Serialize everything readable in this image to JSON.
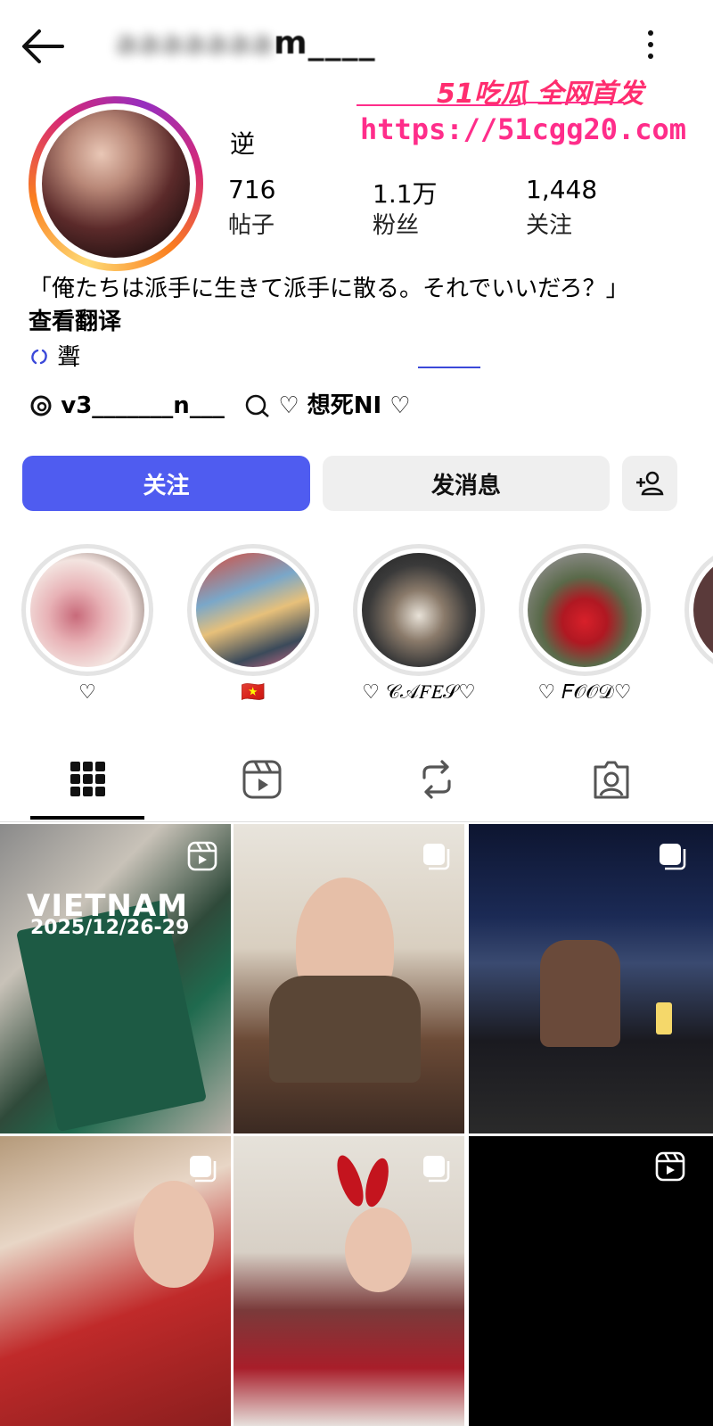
{
  "header": {
    "username": "m____",
    "back_icon": "arrow-left-icon",
    "more_icon": "more-vertical-icon"
  },
  "watermark": {
    "line1": "51吃瓜 全网首发",
    "line2": "https://51cgg20.com"
  },
  "profile": {
    "display_name": "逆",
    "stats": [
      {
        "value": "716",
        "label": "帖子"
      },
      {
        "value": "1.1万",
        "label": "粉丝"
      },
      {
        "value": "1,448",
        "label": "关注"
      }
    ],
    "bio": "「俺たちは派手に生きて派手に散る。それでいいだろ？」",
    "translate": "查看翻译",
    "link_text": "聻",
    "threads_handle": "v3_______n___",
    "threads_note": "♡ 想死NI ♡"
  },
  "actions": {
    "follow": "关注",
    "message": "发消息",
    "add_user_icon": "add-user-icon"
  },
  "highlights": [
    {
      "label": "♡"
    },
    {
      "label": "🇻🇳"
    },
    {
      "label": "♡ 𝒞𝒜𝐹𝐸𝒮♡"
    },
    {
      "label": "♡ 𝐹𝒪𝒪𝒟♡"
    }
  ],
  "tabs": [
    "grid-icon",
    "reels-icon",
    "reposts-icon",
    "tagged-icon"
  ],
  "grid": {
    "first_title": "VIETNAM",
    "first_date": "2025/12/26-29"
  },
  "colors": {
    "follow_button": "#4f5cf0",
    "secondary_button": "#efefef",
    "watermark": "#ff2d6f"
  }
}
